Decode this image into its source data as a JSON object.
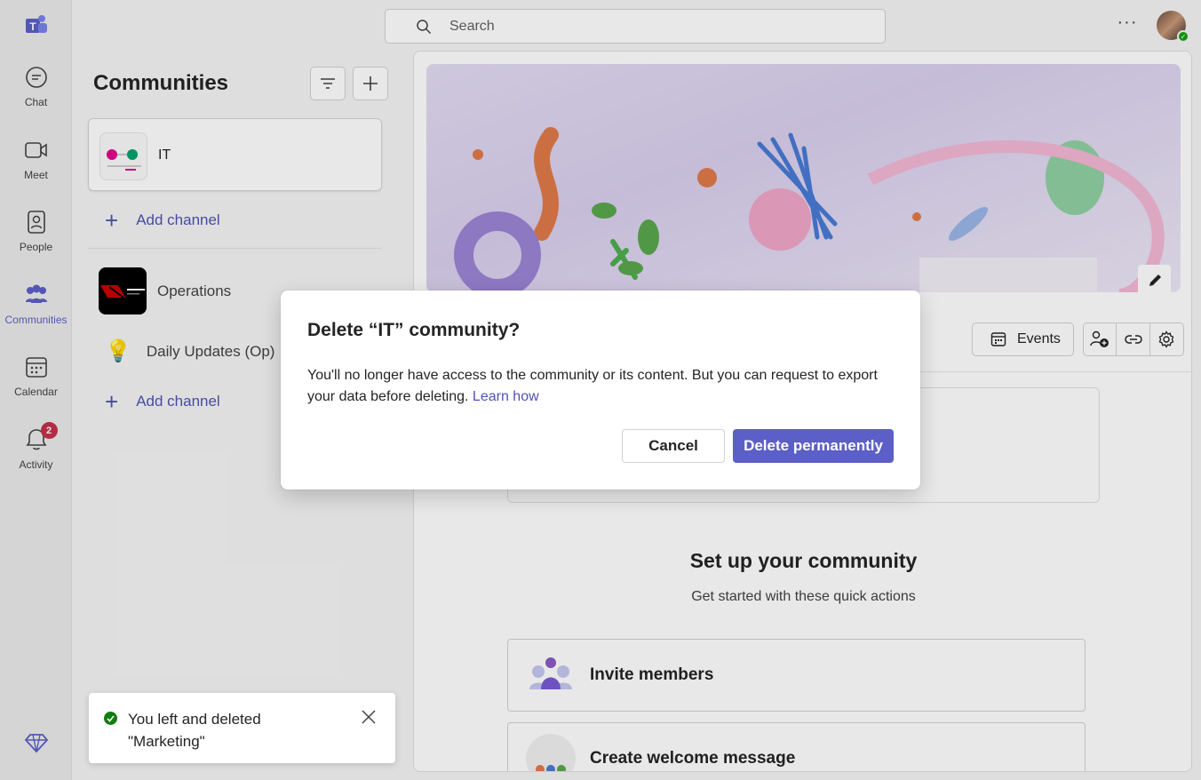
{
  "rail": {
    "items": [
      {
        "label": "Chat",
        "icon": "chat-icon"
      },
      {
        "label": "Meet",
        "icon": "video-icon"
      },
      {
        "label": "People",
        "icon": "people-icon"
      },
      {
        "label": "Communities",
        "icon": "communities-icon",
        "active": true
      },
      {
        "label": "Calendar",
        "icon": "calendar-icon"
      },
      {
        "label": "Activity",
        "icon": "bell-icon",
        "badge": "2"
      }
    ],
    "accent": "#5b5fc7"
  },
  "search": {
    "placeholder": "Search"
  },
  "sidebar": {
    "title": "Communities",
    "communities": [
      {
        "name": "IT",
        "add_channel": "Add channel"
      },
      {
        "name": "Operations",
        "channels": [
          "Daily Updates (Op)"
        ],
        "add_channel": "Add channel"
      }
    ]
  },
  "main": {
    "events_label": "Events",
    "setup_title": "Set up your community",
    "setup_subtitle": "Get started with these quick actions",
    "actions": [
      "Invite members",
      "Create welcome message"
    ]
  },
  "dialog": {
    "title": "Delete “IT” community?",
    "body": "You'll no longer have access to the community or its content. But you can request to export your data before deleting.",
    "link": "Learn how",
    "cancel_label": "Cancel",
    "confirm_label": "Delete permanently",
    "confirm_color": "#5b5fc7"
  },
  "toast": {
    "message": "You left and deleted \"Marketing\"",
    "status_color": "#107c10"
  }
}
